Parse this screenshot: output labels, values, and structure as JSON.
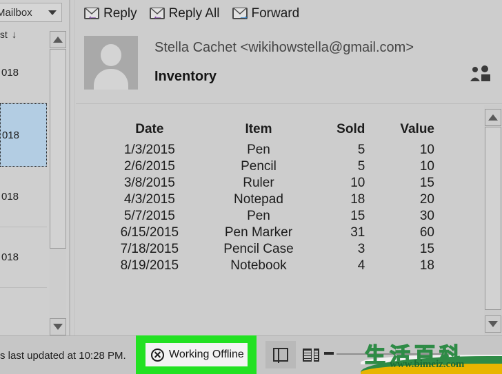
{
  "sidebar": {
    "mailbox_dropdown": "Mailbox",
    "sort_label": "west",
    "sort_arrow": "↓",
    "messages": [
      {
        "date": "018"
      },
      {
        "date": "018"
      },
      {
        "date": "018"
      },
      {
        "date": "018"
      }
    ]
  },
  "toolbar": {
    "reply": "Reply",
    "reply_all": "Reply All",
    "forward": "Forward"
  },
  "message": {
    "sender": "Stella Cachet <wikihowstella@gmail.com>",
    "subject": "Inventory"
  },
  "table": {
    "headers": [
      "Date",
      "Item",
      "Sold",
      "Value"
    ],
    "rows": [
      [
        "1/3/2015",
        "Pen",
        "5",
        "10"
      ],
      [
        "2/6/2015",
        "Pencil",
        "5",
        "10"
      ],
      [
        "3/8/2015",
        "Ruler",
        "10",
        "15"
      ],
      [
        "4/3/2015",
        "Notepad",
        "18",
        "20"
      ],
      [
        "5/7/2015",
        "Pen",
        "15",
        "30"
      ],
      [
        "6/15/2015",
        "Pen Marker",
        "31",
        "60"
      ],
      [
        "7/18/2015",
        "Pencil Case",
        "3",
        "15"
      ],
      [
        "8/19/2015",
        "Notebook",
        "4",
        "18"
      ]
    ]
  },
  "statusbar": {
    "status_text": "s last updated at 10:28 PM.",
    "working_offline": "Working Offline",
    "highlight_color": "#22e122"
  },
  "watermark": {
    "chinese": "生活百科",
    "url": "www.bimeiz.com"
  }
}
